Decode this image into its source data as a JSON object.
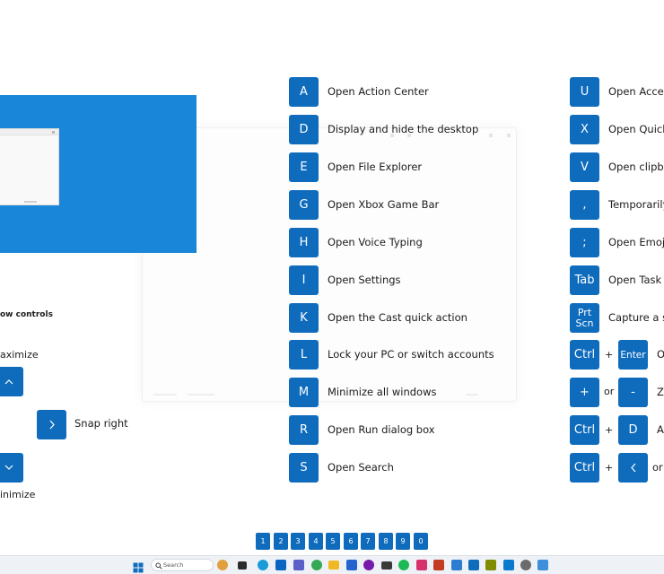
{
  "left_panel": {
    "title": "ow controls",
    "maximize_label": "aximize",
    "snap_right_label": "Snap right",
    "minimize_label": "inimize"
  },
  "middle_shortcuts": [
    {
      "key": "A",
      "label": "Open Action Center"
    },
    {
      "key": "D",
      "label": "Display and hide the desktop"
    },
    {
      "key": "E",
      "label": "Open File Explorer"
    },
    {
      "key": "G",
      "label": "Open Xbox Game Bar"
    },
    {
      "key": "H",
      "label": "Open Voice Typing"
    },
    {
      "key": "I",
      "label": "Open Settings"
    },
    {
      "key": "K",
      "label": "Open the Cast quick action"
    },
    {
      "key": "L",
      "label": "Lock your PC or switch accounts"
    },
    {
      "key": "M",
      "label": "Minimize all windows"
    },
    {
      "key": "R",
      "label": "Open Run dialog box"
    },
    {
      "key": "S",
      "label": "Open Search"
    }
  ],
  "right_shortcuts": {
    "u": {
      "key": "U",
      "label": "Open Access"
    },
    "x": {
      "key": "X",
      "label": "Open Quick L"
    },
    "v": {
      "key": "V",
      "label": "Open clipboa"
    },
    "comma": {
      "key": ",",
      "label": "Temporarily p"
    },
    "semicolon": {
      "key": ";",
      "label": "Open Emoji p"
    },
    "tab": {
      "key": "Tab",
      "label": "Open Task vi"
    },
    "prtscn": {
      "key_line1": "Prt",
      "key_line2": "Scn",
      "label": "Capture a scr"
    },
    "ctrl_enter": {
      "key1": "Ctrl",
      "op": "+",
      "key2": "Enter",
      "label": "O"
    },
    "zoom": {
      "key1": "+",
      "op": "or",
      "key2": "-",
      "label": "Zo"
    },
    "ctrl_d": {
      "key1": "Ctrl",
      "op": "+",
      "key2": "D",
      "label": "A"
    },
    "ctrl_left": {
      "key1": "Ctrl",
      "op": "+",
      "label": "or"
    }
  },
  "number_keys": [
    "1",
    "2",
    "3",
    "4",
    "5",
    "6",
    "7",
    "8",
    "9",
    "0"
  ],
  "taskbar": {
    "search_label": "Search",
    "icons": [
      {
        "name": "windows-start-icon",
        "color": "#0f6cbd"
      },
      {
        "name": "widgets-icon",
        "color": "#e0a040"
      },
      {
        "name": "task-view-icon",
        "color": "#2b2b2b"
      },
      {
        "name": "edge-icon",
        "color": "#1a9bd8"
      },
      {
        "name": "outlook-icon",
        "color": "#0a64c2"
      },
      {
        "name": "teams-icon",
        "color": "#5b5fc7"
      },
      {
        "name": "chrome-icon",
        "color": "#34a853"
      },
      {
        "name": "file-explorer-icon",
        "color": "#f2b824"
      },
      {
        "name": "calendar-icon",
        "color": "#2564cf"
      },
      {
        "name": "onenote-icon",
        "color": "#7719aa"
      },
      {
        "name": "terminal-icon",
        "color": "#3a3a3a"
      },
      {
        "name": "spotify-icon",
        "color": "#1db954"
      },
      {
        "name": "photos-icon",
        "color": "#d6336c"
      },
      {
        "name": "paint-icon",
        "color": "#c23b22"
      },
      {
        "name": "store-icon",
        "color": "#2c7cd2"
      },
      {
        "name": "dev-icon",
        "color": "#0f6cbd"
      },
      {
        "name": "cube-icon",
        "color": "#7f8c00"
      },
      {
        "name": "vscode-icon",
        "color": "#0a7acc"
      },
      {
        "name": "settings-icon",
        "color": "#6b6b6b"
      },
      {
        "name": "notepad-icon",
        "color": "#3c8fd8"
      }
    ]
  },
  "colors": {
    "accent": "#0f6cbd",
    "snap_preview": "#1a86d9"
  }
}
